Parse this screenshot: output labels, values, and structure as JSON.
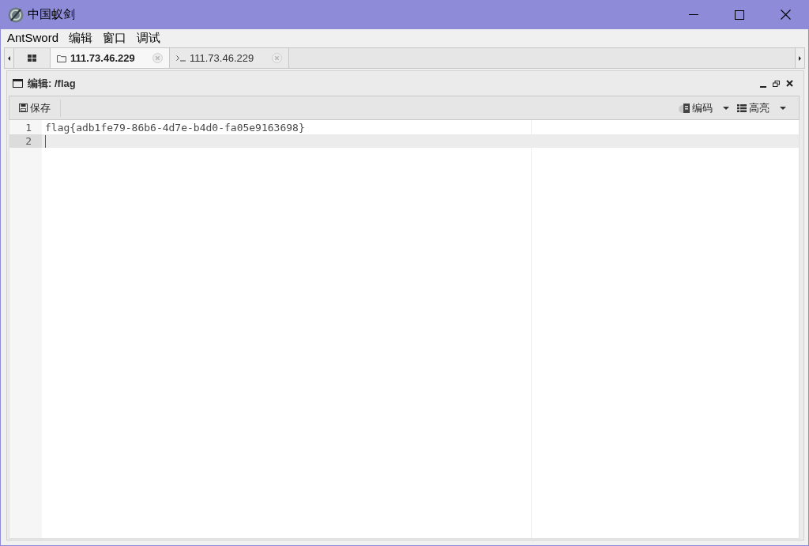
{
  "window": {
    "title": "中国蚁剑"
  },
  "menu": [
    "AntSword",
    "编辑",
    "窗口",
    "调试"
  ],
  "tabs": [
    {
      "kind": "home",
      "selected": false
    },
    {
      "kind": "files",
      "label": "111.73.46.229",
      "selected": true
    },
    {
      "kind": "terminal",
      "label": "111.73.46.229",
      "selected": false
    }
  ],
  "panel": {
    "title": "编辑: /flag"
  },
  "toolbar": {
    "left": [
      {
        "kind": "save",
        "label": "保存"
      }
    ],
    "right": [
      {
        "kind": "encoding",
        "label": "编码"
      },
      {
        "kind": "highlight",
        "label": "高亮"
      }
    ]
  },
  "editor": {
    "lines": [
      {
        "number": "1",
        "text": "flag{adb1fe79-86b6-4d7e-b4d0-fa05e9163698}",
        "active": false
      },
      {
        "number": "2",
        "active": true
      }
    ]
  }
}
